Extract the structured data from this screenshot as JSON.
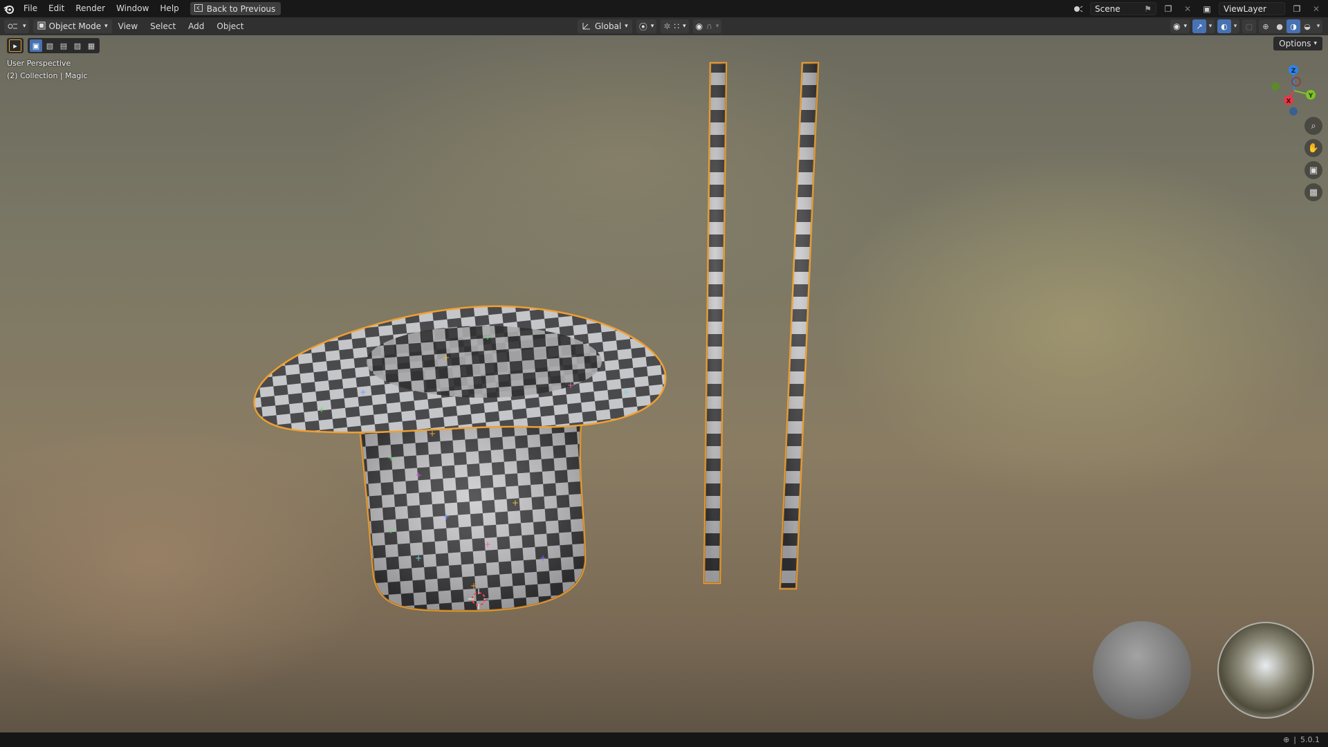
{
  "topbar": {
    "menus": [
      "File",
      "Edit",
      "Render",
      "Window",
      "Help"
    ],
    "back_button": "Back to Previous",
    "scene_name": "Scene",
    "view_layer": "ViewLayer"
  },
  "header": {
    "mode": "Object Mode",
    "menus": [
      "View",
      "Select",
      "Add",
      "Object"
    ],
    "transform_orientation": "Global"
  },
  "viewport": {
    "options_label": "Options",
    "perspective_label": "User Perspective",
    "collection_label": "(2) Collection | Magic",
    "gizmo_axes": [
      "Z",
      "X",
      "Y"
    ]
  },
  "status": {
    "version": "5.0.1"
  },
  "colors": {
    "accent": "#4772b3",
    "selection_outline": "#f0a030",
    "axis_x": "#e8374b",
    "axis_y": "#7ec227",
    "axis_z": "#2f83e6"
  },
  "icons": [
    "blender-logo-icon",
    "back-icon",
    "scene-icon",
    "pin-icon",
    "viewlayer-icon",
    "editor-type-icon",
    "mode-icon",
    "orientation-icon",
    "snap-icon",
    "proportional-icon",
    "visibility-icon",
    "gizmo-icon",
    "overlay-icon",
    "shading-icon",
    "zoom-icon",
    "pan-icon",
    "camera-icon",
    "grid-icon",
    "world-icon"
  ]
}
